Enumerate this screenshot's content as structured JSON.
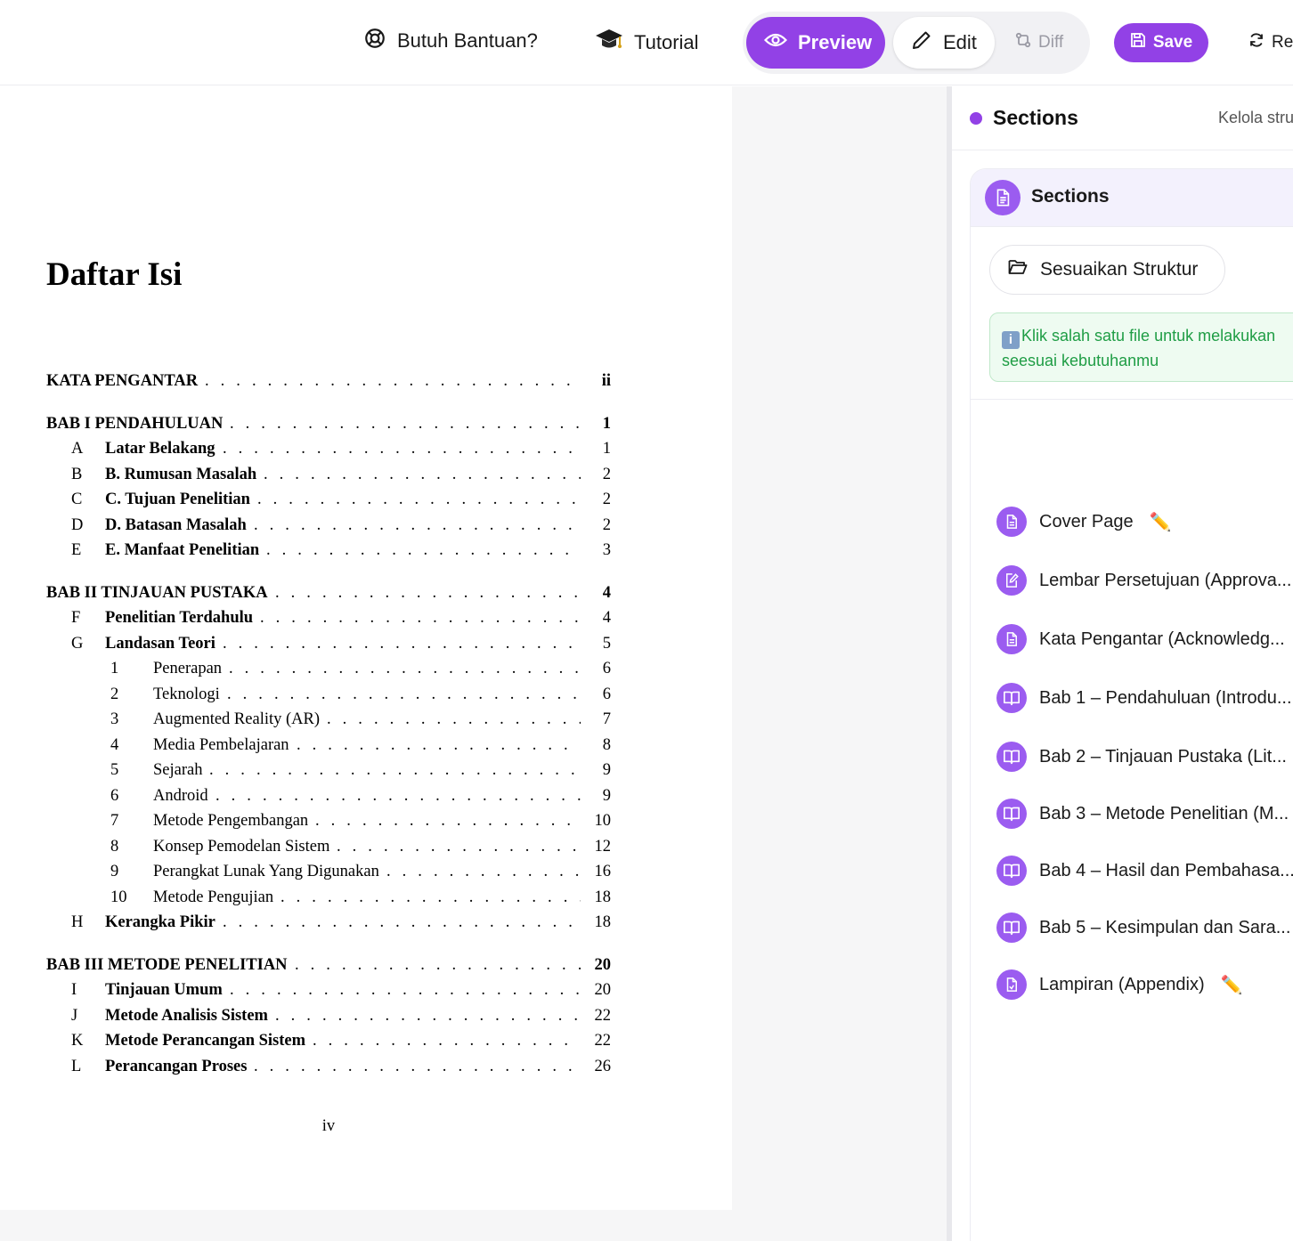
{
  "toolbar": {
    "help_label": "Butuh Bantuan?",
    "tutorial_label": "Tutorial",
    "preview_label": "Preview",
    "edit_label": "Edit",
    "diff_label": "Diff",
    "save_label": "Save",
    "refresh_label": "Ref",
    "active_mode": "Preview",
    "accent_color": "#9241e6"
  },
  "document": {
    "title": "Daftar Isi",
    "page_number": "iv",
    "toc": [
      {
        "num": "",
        "label": "KATA PENGANTAR",
        "page": "ii",
        "level": 0,
        "bold": true
      },
      {
        "num": "",
        "label": "BAB I PENDAHULUAN",
        "page": "1",
        "level": 0,
        "bold": true
      },
      {
        "num": "A",
        "label": "Latar Belakang",
        "page": "1",
        "level": 1,
        "bold": true
      },
      {
        "num": "B",
        "label": "B. Rumusan Masalah",
        "page": "2",
        "level": 1,
        "bold": true
      },
      {
        "num": "C",
        "label": "C. Tujuan Penelitian",
        "page": "2",
        "level": 1,
        "bold": true
      },
      {
        "num": "D",
        "label": "D. Batasan Masalah",
        "page": "2",
        "level": 1,
        "bold": true
      },
      {
        "num": "E",
        "label": "E. Manfaat Penelitian",
        "page": "3",
        "level": 1,
        "bold": true
      },
      {
        "num": "",
        "label": "BAB II TINJAUAN PUSTAKA",
        "page": "4",
        "level": 0,
        "bold": true
      },
      {
        "num": "F",
        "label": "Penelitian Terdahulu",
        "page": "4",
        "level": 1,
        "bold": true
      },
      {
        "num": "G",
        "label": "Landasan Teori",
        "page": "5",
        "level": 1,
        "bold": true
      },
      {
        "num": "1",
        "label": "Penerapan",
        "page": "6",
        "level": 2,
        "bold": false
      },
      {
        "num": "2",
        "label": "Teknologi",
        "page": "6",
        "level": 2,
        "bold": false
      },
      {
        "num": "3",
        "label": "Augmented Reality (AR)",
        "page": "7",
        "level": 2,
        "bold": false
      },
      {
        "num": "4",
        "label": "Media Pembelajaran",
        "page": "8",
        "level": 2,
        "bold": false
      },
      {
        "num": "5",
        "label": "Sejarah",
        "page": "9",
        "level": 2,
        "bold": false
      },
      {
        "num": "6",
        "label": "Android",
        "page": "9",
        "level": 2,
        "bold": false
      },
      {
        "num": "7",
        "label": "Metode Pengembangan",
        "page": "10",
        "level": 2,
        "bold": false
      },
      {
        "num": "8",
        "label": "Konsep Pemodelan Sistem",
        "page": "12",
        "level": 2,
        "bold": false
      },
      {
        "num": "9",
        "label": "Perangkat Lunak Yang Digunakan",
        "page": "16",
        "level": 2,
        "bold": false
      },
      {
        "num": "10",
        "label": "Metode Pengujian",
        "page": "18",
        "level": 2,
        "bold": false
      },
      {
        "num": "H",
        "label": "Kerangka Pikir",
        "page": "18",
        "level": 1,
        "bold": true
      },
      {
        "num": "",
        "label": "BAB III METODE PENELITIAN",
        "page": "20",
        "level": 0,
        "bold": true
      },
      {
        "num": "I",
        "label": "Tinjauan Umum",
        "page": "20",
        "level": 1,
        "bold": true
      },
      {
        "num": "J",
        "label": "Metode Analisis Sistem",
        "page": "22",
        "level": 1,
        "bold": true
      },
      {
        "num": "K",
        "label": "Metode Perancangan Sistem",
        "page": "22",
        "level": 1,
        "bold": true
      },
      {
        "num": "L",
        "label": "Perancangan Proses",
        "page": "26",
        "level": 1,
        "bold": true
      }
    ]
  },
  "panel": {
    "title": "Sections",
    "subtitle": "Kelola stru",
    "card_title": "Sections",
    "struct_button": "Sesuaikan Struktur",
    "hint_line1": "Klik salah satu file untuk melakukan",
    "hint_line2": "seesuai kebutuhanmu",
    "sections": [
      {
        "label": "Cover Page",
        "icon": "document-icon",
        "editable": true
      },
      {
        "label": "Lembar Persetujuan (Approva...",
        "icon": "edit-document-icon",
        "editable": false
      },
      {
        "label": "Kata Pengantar (Acknowledg...",
        "icon": "document-icon",
        "editable": false
      },
      {
        "label": "Bab 1 – Pendahuluan (Introdu...",
        "icon": "book-icon",
        "editable": false
      },
      {
        "label": "Bab 2 – Tinjauan Pustaka (Lit...",
        "icon": "book-icon",
        "editable": false
      },
      {
        "label": "Bab 3 – Metode Penelitian (M...",
        "icon": "book-icon",
        "editable": false
      },
      {
        "label": "Bab 4 – Hasil dan Pembahasa...",
        "icon": "book-icon",
        "editable": false
      },
      {
        "label": "Bab 5 – Kesimpulan dan Sara...",
        "icon": "book-icon",
        "editable": false
      },
      {
        "label": "Lampiran (Appendix)",
        "icon": "attachment-doc-icon",
        "editable": true
      }
    ]
  }
}
